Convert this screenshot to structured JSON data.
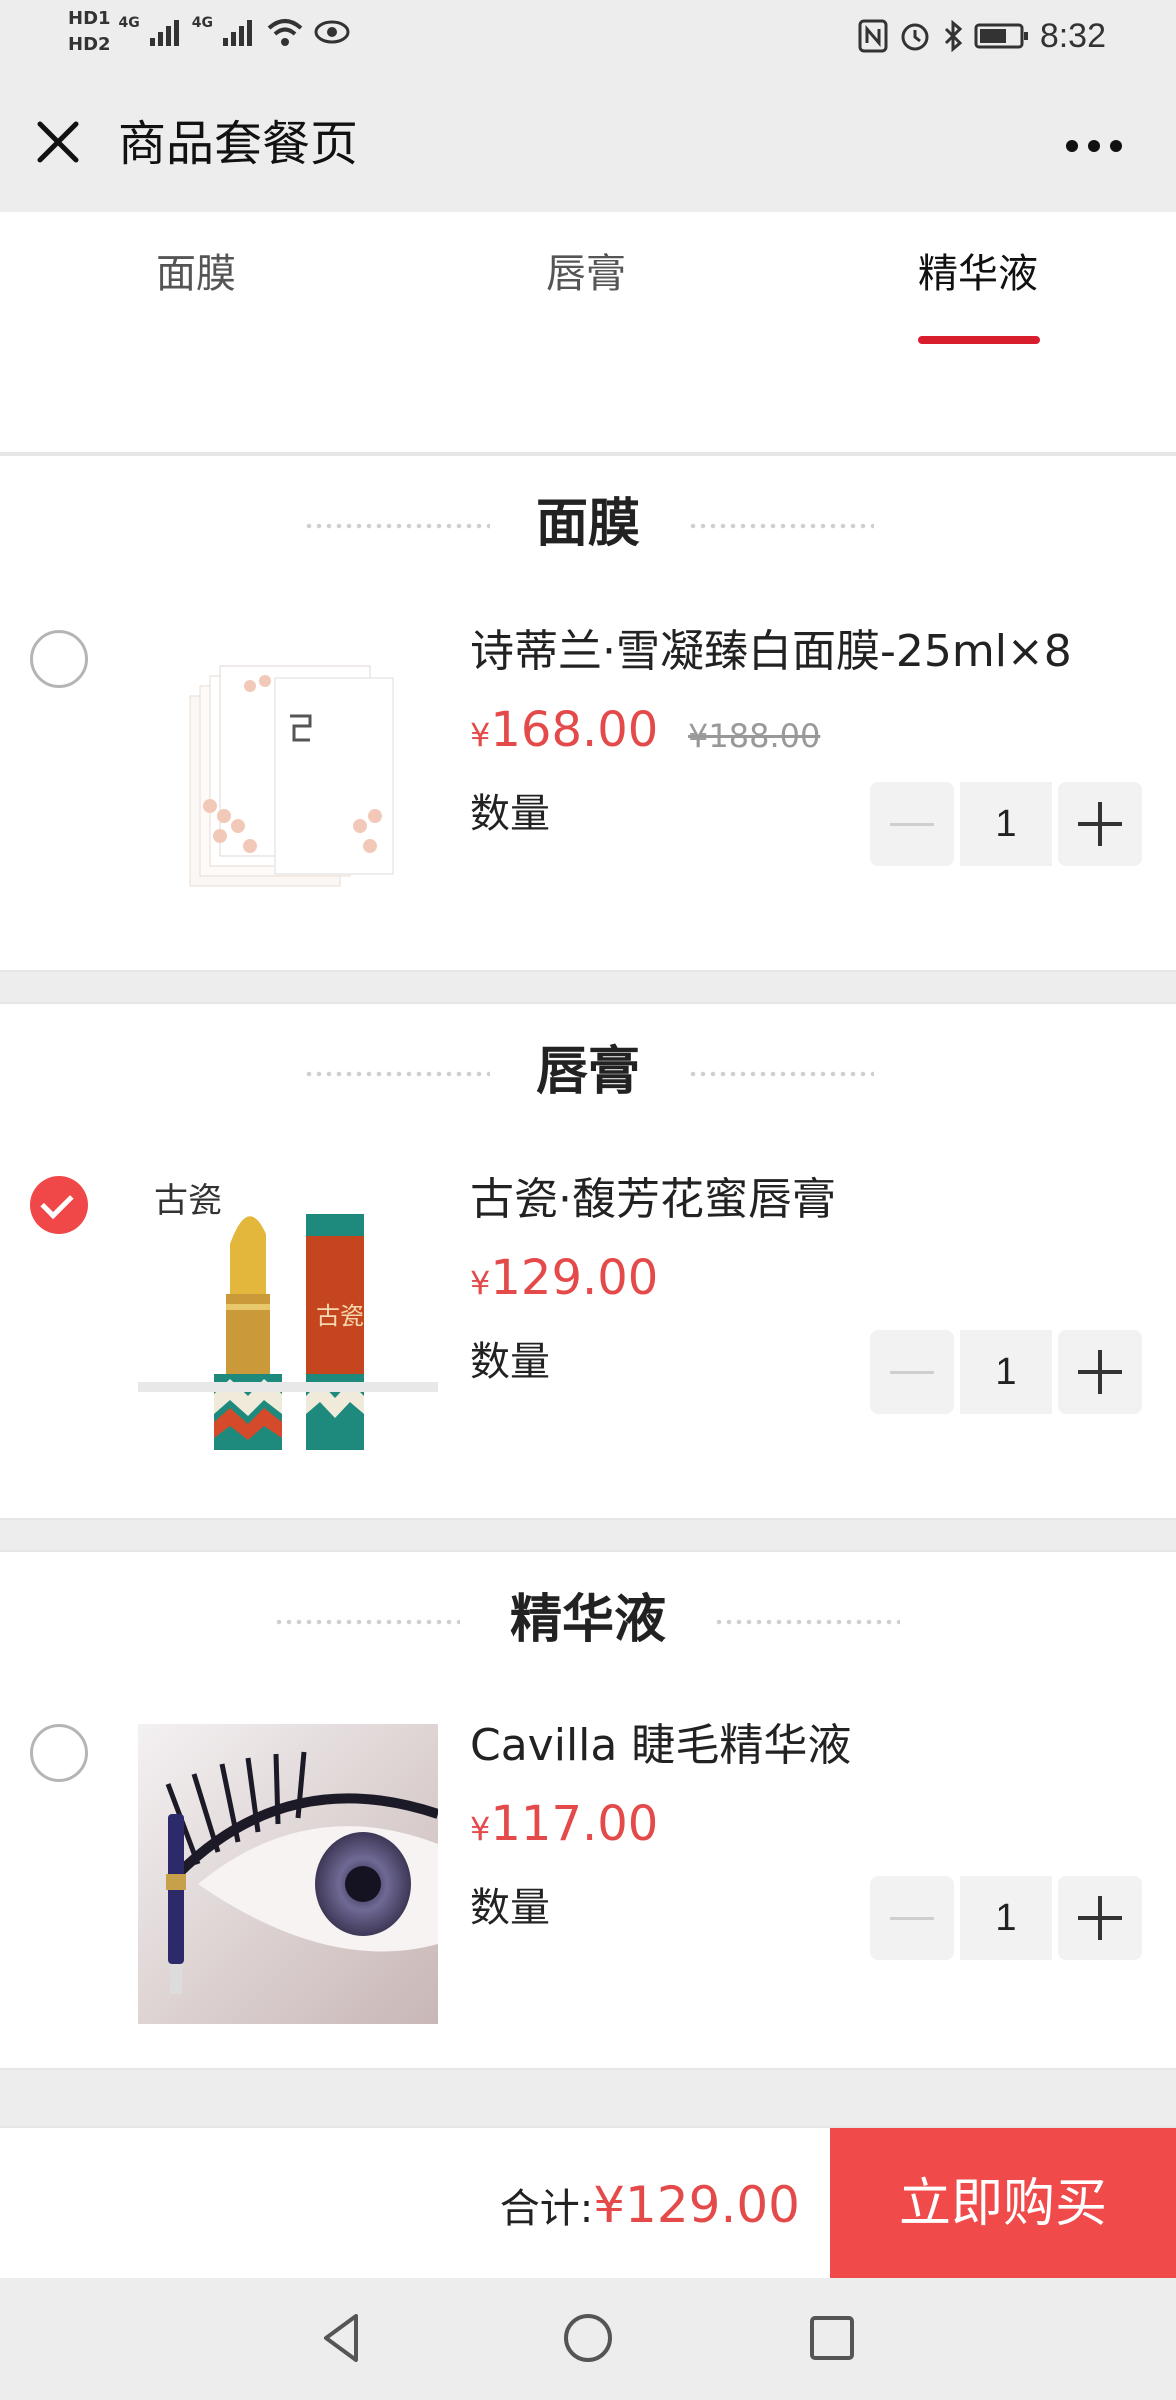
{
  "status_bar": {
    "hd1": "HD1",
    "hd2": "HD2",
    "network1": "4G",
    "network2": "4G",
    "time": "8:32"
  },
  "title_bar": {
    "title": "商品套餐页"
  },
  "tabs": [
    {
      "label": "面膜",
      "active": false
    },
    {
      "label": "唇膏",
      "active": false
    },
    {
      "label": "精华液",
      "active": true
    }
  ],
  "sections": [
    {
      "title": "面膜",
      "product": {
        "name": "诗蒂兰·雪凝臻白面膜-25ml×8",
        "currency": "¥",
        "price": "168.00",
        "original_price": "¥188.00",
        "qty_label": "数量",
        "qty": "1",
        "selected": false
      }
    },
    {
      "title": "唇膏",
      "product": {
        "name": "古瓷·馥芳花蜜唇膏",
        "currency": "¥",
        "price": "129.00",
        "qty_label": "数量",
        "qty": "1",
        "selected": true
      }
    },
    {
      "title": "精华液",
      "product": {
        "name": "Cavilla 睫毛精华液",
        "currency": "¥",
        "price": "117.00",
        "qty_label": "数量",
        "qty": "1",
        "selected": false
      }
    }
  ],
  "footer": {
    "total_label": "合计:",
    "total_price": "¥129.00",
    "buy_label": "立即购买"
  },
  "colors": {
    "accent": "#f04a4a",
    "price": "#e44a4a",
    "tab_indicator": "#d81e2c"
  }
}
